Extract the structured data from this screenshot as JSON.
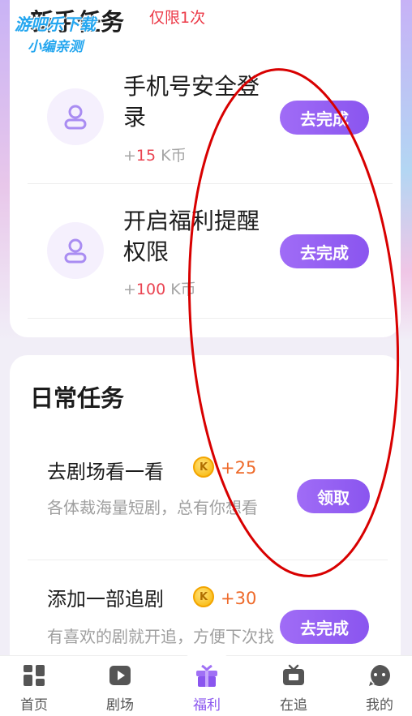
{
  "newbie_section": {
    "title": "新手任务",
    "tag": "仅限1次",
    "tasks": [
      {
        "name": "手机号安全登录",
        "reward_prefix": "+",
        "reward_value": "15",
        "reward_unit": " K币",
        "button": "去完成",
        "icon": "user-icon"
      },
      {
        "name": "开启福利提醒权限",
        "reward_prefix": "+",
        "reward_value": "100",
        "reward_unit": " K币",
        "button": "去完成",
        "icon": "user-icon"
      }
    ]
  },
  "daily_section": {
    "title": "日常任务",
    "tasks": [
      {
        "name": "去剧场看一看",
        "coin": "K",
        "reward": "+25",
        "desc": "各体裁海量短剧，总有你想看",
        "button": "领取"
      },
      {
        "name": "添加一部追剧",
        "coin": "K",
        "reward": "+30",
        "desc": "有喜欢的剧就开追，方便下次找",
        "button": "去完成"
      }
    ]
  },
  "tabbar": {
    "items": [
      {
        "label": "首页",
        "icon": "home-grid-icon",
        "active": false
      },
      {
        "label": "剧场",
        "icon": "play-icon",
        "active": false
      },
      {
        "label": "福利",
        "icon": "gift-icon",
        "active": true
      },
      {
        "label": "在追",
        "icon": "tv-icon",
        "active": false
      },
      {
        "label": "我的",
        "icon": "profile-face-icon",
        "active": false
      }
    ]
  },
  "watermark": {
    "line1": "游吧乐下载",
    "line2": "小编亲测"
  },
  "colors": {
    "accent": "#8a55ef",
    "tag_red": "#ec3a48",
    "reward_orange": "#ee6a2a",
    "annotation_red": "#d80000"
  }
}
